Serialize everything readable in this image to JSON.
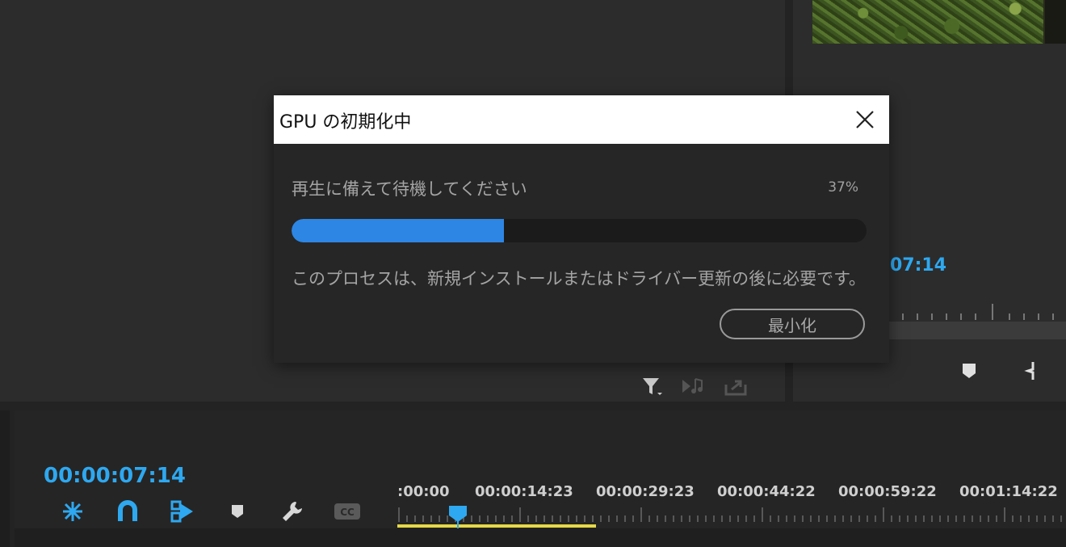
{
  "dialog": {
    "title": "GPU の初期化中",
    "message": "再生に備えて待機してください",
    "percent_label": "37%",
    "progress": 0.37,
    "note": "このプロセスは、新規インストールまたはドライバー更新の後に必要です。",
    "minimize_label": "最小化",
    "close_icon": "close-icon"
  },
  "program_monitor": {
    "timecode": "07:14",
    "icons": [
      "marker-icon",
      "mark-in-icon"
    ]
  },
  "source_monitor": {
    "tools": [
      "filter-icon",
      "audio-video-icon",
      "export-icon"
    ]
  },
  "timeline": {
    "timecode": "00:00:07:14",
    "tools": [
      "ripple-edit-icon",
      "snap-magnet-icon",
      "linked-selection-icon",
      "marker-icon",
      "wrench-icon",
      "captions-icon"
    ],
    "ruler_labels": [
      ":00:00",
      "00:00:14:23",
      "00:00:29:23",
      "00:00:44:22",
      "00:00:59:22",
      "00:01:14:22"
    ]
  },
  "colors": {
    "accent_blue": "#2ea8f0",
    "progress_blue": "#2d86e4",
    "work_area_yellow": "#e6d84a"
  }
}
